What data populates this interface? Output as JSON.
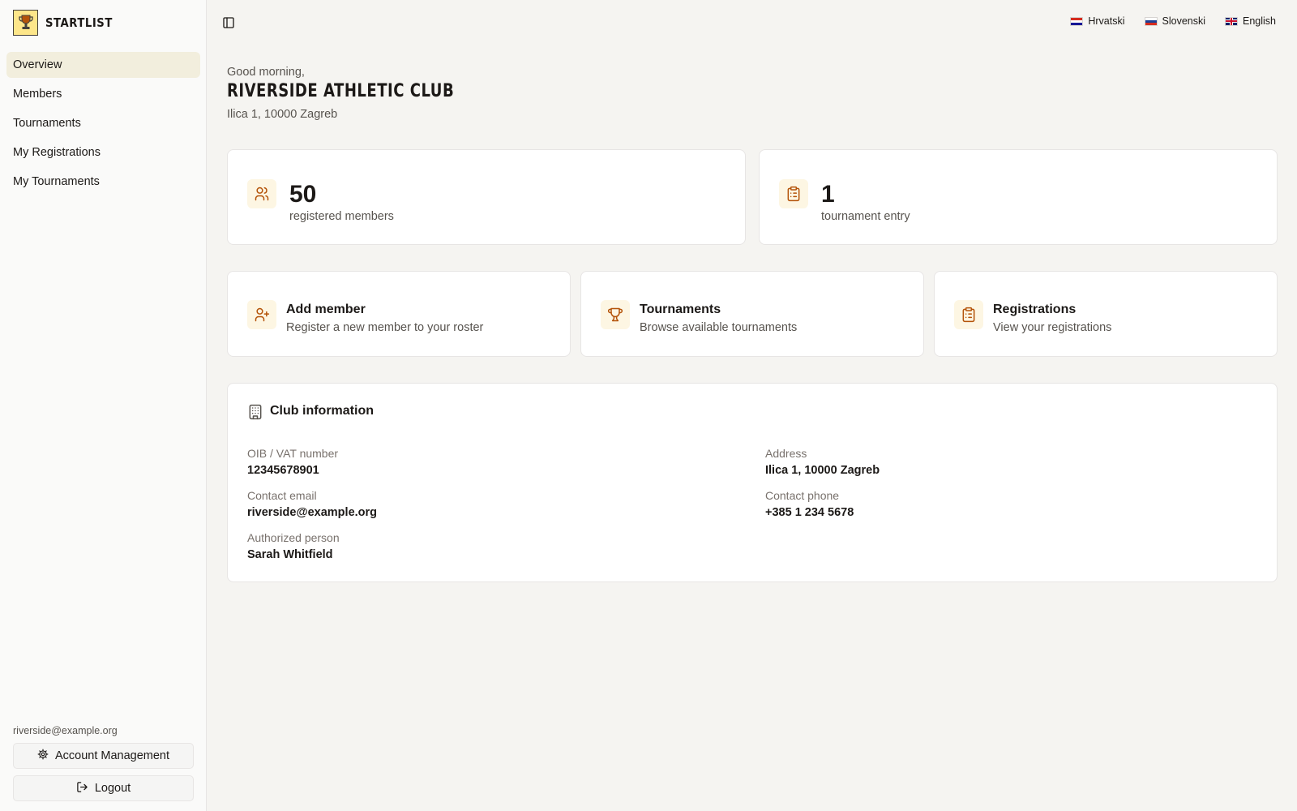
{
  "app": {
    "name": "STARTLIST"
  },
  "sidebar": {
    "items": [
      {
        "label": "Overview",
        "active": true
      },
      {
        "label": "Members"
      },
      {
        "label": "Tournaments"
      },
      {
        "label": "My Registrations"
      },
      {
        "label": "My Tournaments"
      }
    ],
    "user_email": "riverside@example.org",
    "account_label": "Account Management",
    "logout_label": "Logout"
  },
  "languages": [
    {
      "label": "Hrvatski",
      "flag": "hr"
    },
    {
      "label": "Slovenski",
      "flag": "si"
    },
    {
      "label": "English",
      "flag": "gb"
    }
  ],
  "header": {
    "greeting": "Good morning,",
    "club_name": "RIVERSIDE ATHLETIC CLUB",
    "address": "Ilica 1, 10000 Zagreb"
  },
  "stats": [
    {
      "value": "50",
      "label": "registered members",
      "icon": "users-icon"
    },
    {
      "value": "1",
      "label": "tournament entry",
      "icon": "clipboard-icon"
    }
  ],
  "actions": [
    {
      "title": "Add member",
      "subtitle": "Register a new member to your roster",
      "icon": "user-plus-icon"
    },
    {
      "title": "Tournaments",
      "subtitle": "Browse available tournaments",
      "icon": "trophy-icon"
    },
    {
      "title": "Registrations",
      "subtitle": "View your registrations",
      "icon": "clipboard-icon"
    }
  ],
  "club_info": {
    "title": "Club information",
    "oib_label": "OIB / VAT number",
    "oib_value": "12345678901",
    "address_label": "Address",
    "address_value": "Ilica 1, 10000 Zagreb",
    "email_label": "Contact email",
    "email_value": "riverside@example.org",
    "phone_label": "Contact phone",
    "phone_value": "+385 1 234 5678",
    "person_label": "Authorized person",
    "person_value": "Sarah Whitfield"
  },
  "colors": {
    "accent": "#b45309",
    "accent_bg": "#fdf6e3",
    "active_nav": "#f2eedd",
    "page_bg": "#f5f4f1"
  }
}
